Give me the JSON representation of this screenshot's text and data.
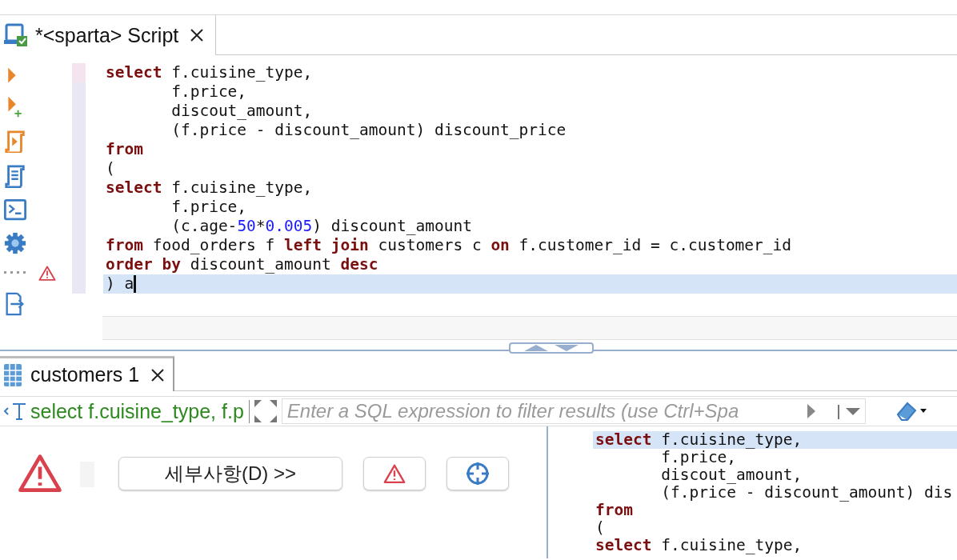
{
  "editor_tab": {
    "title": "*<sparta> Script",
    "selected": true
  },
  "editor": {
    "lines": [
      {
        "current": false,
        "tokens": [
          {
            "kind": "kw",
            "text": "select"
          },
          {
            "kind": "plain",
            "text": " f.cuisine_type,"
          }
        ]
      },
      {
        "current": false,
        "tokens": [
          {
            "kind": "plain",
            "text": "       f.price,"
          }
        ]
      },
      {
        "current": false,
        "tokens": [
          {
            "kind": "plain",
            "text": "       discout_amount,"
          }
        ]
      },
      {
        "current": false,
        "tokens": [
          {
            "kind": "plain",
            "text": "       (f.price - discount_amount) discount_price"
          }
        ]
      },
      {
        "current": false,
        "tokens": [
          {
            "kind": "kw",
            "text": "from"
          }
        ]
      },
      {
        "current": false,
        "tokens": [
          {
            "kind": "plain",
            "text": "("
          }
        ]
      },
      {
        "current": false,
        "tokens": [
          {
            "kind": "kw",
            "text": "select"
          },
          {
            "kind": "plain",
            "text": " f.cuisine_type,"
          }
        ]
      },
      {
        "current": false,
        "tokens": [
          {
            "kind": "plain",
            "text": "       f.price,"
          }
        ]
      },
      {
        "current": false,
        "tokens": [
          {
            "kind": "plain",
            "text": "       (c.age-"
          },
          {
            "kind": "num",
            "text": "50"
          },
          {
            "kind": "plain",
            "text": "*"
          },
          {
            "kind": "num",
            "text": "0.005"
          },
          {
            "kind": "plain",
            "text": ") discount_amount"
          }
        ]
      },
      {
        "current": false,
        "tokens": [
          {
            "kind": "kw",
            "text": "from"
          },
          {
            "kind": "plain",
            "text": " food_orders f "
          },
          {
            "kind": "kw",
            "text": "left join"
          },
          {
            "kind": "plain",
            "text": " customers c "
          },
          {
            "kind": "kw",
            "text": "on"
          },
          {
            "kind": "plain",
            "text": " f.customer_id = c.customer_id"
          }
        ]
      },
      {
        "current": false,
        "tokens": [
          {
            "kind": "kw",
            "text": "order by"
          },
          {
            "kind": "plain",
            "text": " discount_amount "
          },
          {
            "kind": "kw",
            "text": "desc"
          }
        ]
      },
      {
        "current": true,
        "tokens": [
          {
            "kind": "plain",
            "text": ") a"
          }
        ]
      }
    ]
  },
  "results_tab": {
    "title": "customers 1",
    "selected": true
  },
  "filter": {
    "query": "select f.cuisine_type, f.p",
    "placeholder": "Enter a SQL expression to filter results (use Ctrl+Spa"
  },
  "error_panel": {
    "details_button": "세부사항(D) >>"
  },
  "query_text": {
    "lines": [
      {
        "current": true,
        "tokens": [
          {
            "kind": "kw",
            "text": "select"
          },
          {
            "kind": "plain",
            "text": " f.cuisine_type,"
          }
        ]
      },
      {
        "current": false,
        "tokens": [
          {
            "kind": "plain",
            "text": "       f.price,"
          }
        ]
      },
      {
        "current": false,
        "tokens": [
          {
            "kind": "plain",
            "text": "       discout_amount,"
          }
        ]
      },
      {
        "current": false,
        "tokens": [
          {
            "kind": "plain",
            "text": "       (f.price - discount_amount) dis"
          }
        ]
      },
      {
        "current": false,
        "tokens": [
          {
            "kind": "kw",
            "text": "from"
          }
        ]
      },
      {
        "current": false,
        "tokens": [
          {
            "kind": "plain",
            "text": "("
          }
        ]
      },
      {
        "current": false,
        "tokens": [
          {
            "kind": "kw",
            "text": "select"
          },
          {
            "kind": "plain",
            "text": " f.cuisine_type,"
          }
        ]
      }
    ]
  }
}
